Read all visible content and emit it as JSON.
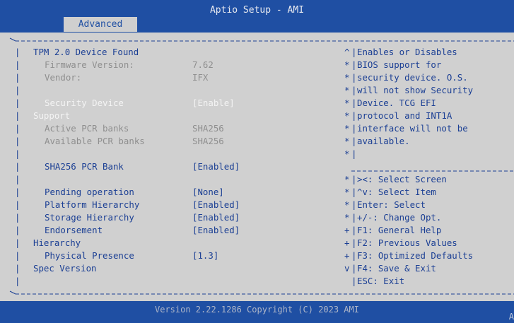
{
  "header": {
    "title": "Aptio Setup - AMI",
    "active_tab": "Advanced"
  },
  "settings": {
    "tpm_found": "TPM 2.0 Device Found",
    "firmware_label": "Firmware Version:",
    "firmware_value": "7.62",
    "vendor_label": "Vendor:",
    "vendor_value": "IFX",
    "security_device_label_1": "Security Device",
    "security_device_label_2": "Support",
    "security_device_value": "[Enable]",
    "active_pcr_label": "Active PCR banks",
    "active_pcr_value": "SHA256",
    "available_pcr_label": "Available PCR banks",
    "available_pcr_value": "SHA256",
    "sha256_label": "SHA256 PCR Bank",
    "sha256_value": "[Enabled]",
    "pending_label": "Pending operation",
    "pending_value": "[None]",
    "platform_label": "Platform Hierarchy",
    "platform_value": "[Enabled]",
    "storage_label": "Storage Hierarchy",
    "storage_value": "[Enabled]",
    "endorsement_label_1": "Endorsement",
    "endorsement_label_2": "Hierarchy",
    "endorsement_value": "[Enabled]",
    "physical_label_1": "Physical Presence",
    "physical_label_2": "Spec Version",
    "physical_value": "[1.3]"
  },
  "help_lines": [
    "Enables or Disables",
    "BIOS support for",
    "security device. O.S.",
    "will not show Security",
    "Device. TCG EFI",
    "protocol and INT1A",
    "interface will not be",
    "available.",
    ""
  ],
  "help_markers": [
    "^",
    "*",
    "*",
    "*",
    "*",
    "*",
    "*",
    "*",
    "*"
  ],
  "key_lines": [
    "><: Select Screen",
    "^v: Select Item",
    "Enter: Select",
    "+/-: Change Opt.",
    "F1: General Help",
    "F2: Previous Values",
    "F3: Optimized Defaults",
    "F4: Save & Exit",
    "ESC: Exit"
  ],
  "key_markers": [
    "*",
    "*",
    "*",
    "*",
    "+",
    "+",
    "+",
    "v",
    ""
  ],
  "footer": {
    "version": "Version 2.22.1286 Copyright (C) 2023 AMI",
    "corner": "A"
  }
}
